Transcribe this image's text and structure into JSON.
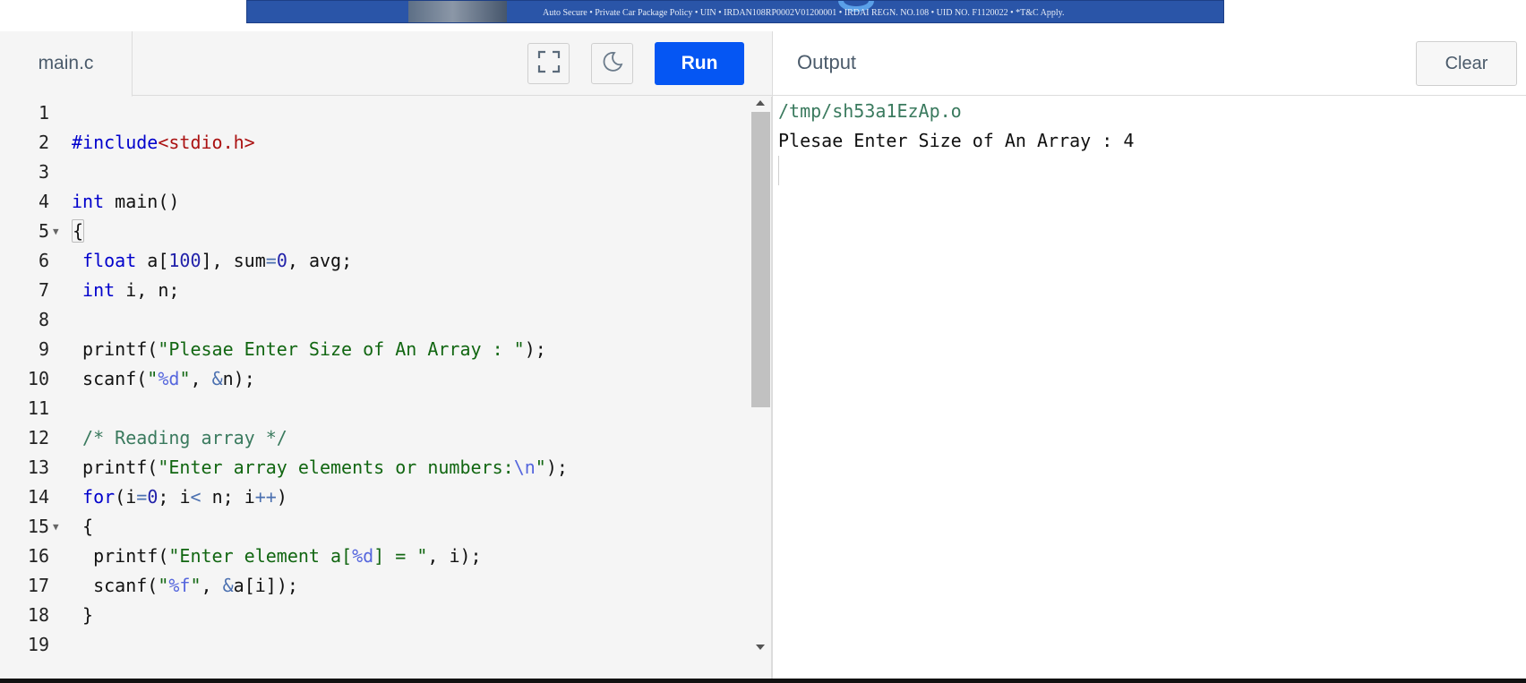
{
  "ad": {
    "text": "Auto Secure • Private Car Package Policy • UIN • IRDAN108RP0002V01200001 • IRDAI REGN. NO.108 • UID NO. F1120022 • *T&C Apply."
  },
  "editor": {
    "file_tab": "main.c",
    "run_label": "Run",
    "lines": [
      {
        "num": "1",
        "fold": false,
        "tokens": []
      },
      {
        "num": "2",
        "fold": false,
        "tokens": [
          [
            "inc",
            "#include"
          ],
          [
            "hdr",
            "<stdio.h>"
          ]
        ]
      },
      {
        "num": "3",
        "fold": false,
        "tokens": []
      },
      {
        "num": "4",
        "fold": false,
        "tokens": [
          [
            "kw",
            "int"
          ],
          [
            "",
            ""
          ],
          [
            "",
            " main()"
          ]
        ]
      },
      {
        "num": "5",
        "fold": true,
        "tokens": [
          [
            "brace",
            "{"
          ]
        ]
      },
      {
        "num": "6",
        "fold": false,
        "tokens": [
          [
            "",
            " "
          ],
          [
            "kw",
            "float"
          ],
          [
            "",
            " a["
          ],
          [
            "num",
            "100"
          ],
          [
            "",
            "], sum"
          ],
          [
            "op",
            "="
          ],
          [
            "num",
            "0"
          ],
          [
            "",
            ", avg;"
          ]
        ]
      },
      {
        "num": "7",
        "fold": false,
        "tokens": [
          [
            "",
            " "
          ],
          [
            "kw",
            "int"
          ],
          [
            "",
            " i, n;"
          ]
        ]
      },
      {
        "num": "8",
        "fold": false,
        "tokens": []
      },
      {
        "num": "9",
        "fold": false,
        "tokens": [
          [
            "",
            " printf("
          ],
          [
            "str",
            "\"Plesae Enter Size of An Array : \""
          ],
          [
            "",
            ");"
          ]
        ]
      },
      {
        "num": "10",
        "fold": false,
        "tokens": [
          [
            "",
            " scanf("
          ],
          [
            "str",
            "\""
          ],
          [
            "esc",
            "%d"
          ],
          [
            "str",
            "\""
          ],
          [
            "",
            ", "
          ],
          [
            "op",
            "&"
          ],
          [
            "",
            "n);"
          ]
        ]
      },
      {
        "num": "11",
        "fold": false,
        "tokens": []
      },
      {
        "num": "12",
        "fold": false,
        "tokens": [
          [
            "",
            " "
          ],
          [
            "cmt",
            "/* Reading array */"
          ]
        ]
      },
      {
        "num": "13",
        "fold": false,
        "tokens": [
          [
            "",
            " printf("
          ],
          [
            "str",
            "\"Enter array elements or numbers:"
          ],
          [
            "esc",
            "\\n"
          ],
          [
            "str",
            "\""
          ],
          [
            "",
            ");"
          ]
        ]
      },
      {
        "num": "14",
        "fold": false,
        "tokens": [
          [
            "",
            " "
          ],
          [
            "kw",
            "for"
          ],
          [
            "",
            "(i"
          ],
          [
            "op",
            "="
          ],
          [
            "num",
            "0"
          ],
          [
            "",
            "; i"
          ],
          [
            "op",
            "<"
          ],
          [
            "",
            " n; i"
          ],
          [
            "op",
            "++"
          ],
          [
            "",
            ")"
          ]
        ]
      },
      {
        "num": "15",
        "fold": true,
        "tokens": [
          [
            "",
            " {"
          ]
        ]
      },
      {
        "num": "16",
        "fold": false,
        "tokens": [
          [
            "",
            "  printf("
          ],
          [
            "str",
            "\"Enter element a["
          ],
          [
            "esc",
            "%d"
          ],
          [
            "str",
            "] = \""
          ],
          [
            "",
            ", i);"
          ]
        ]
      },
      {
        "num": "17",
        "fold": false,
        "tokens": [
          [
            "",
            "  scanf("
          ],
          [
            "str",
            "\""
          ],
          [
            "esc",
            "%f"
          ],
          [
            "str",
            "\""
          ],
          [
            "",
            ", "
          ],
          [
            "op",
            "&"
          ],
          [
            "",
            "a[i]);"
          ]
        ]
      },
      {
        "num": "18",
        "fold": false,
        "tokens": [
          [
            "",
            " }"
          ]
        ]
      },
      {
        "num": "19",
        "fold": false,
        "tokens": []
      }
    ]
  },
  "output": {
    "title": "Output",
    "clear_label": "Clear",
    "path": "/tmp/sh53a1EzAp.o",
    "prompt_text": "Plesae Enter Size of An Array : 4"
  },
  "icons": {
    "fullscreen": "fullscreen-icon",
    "theme": "moon-icon"
  }
}
